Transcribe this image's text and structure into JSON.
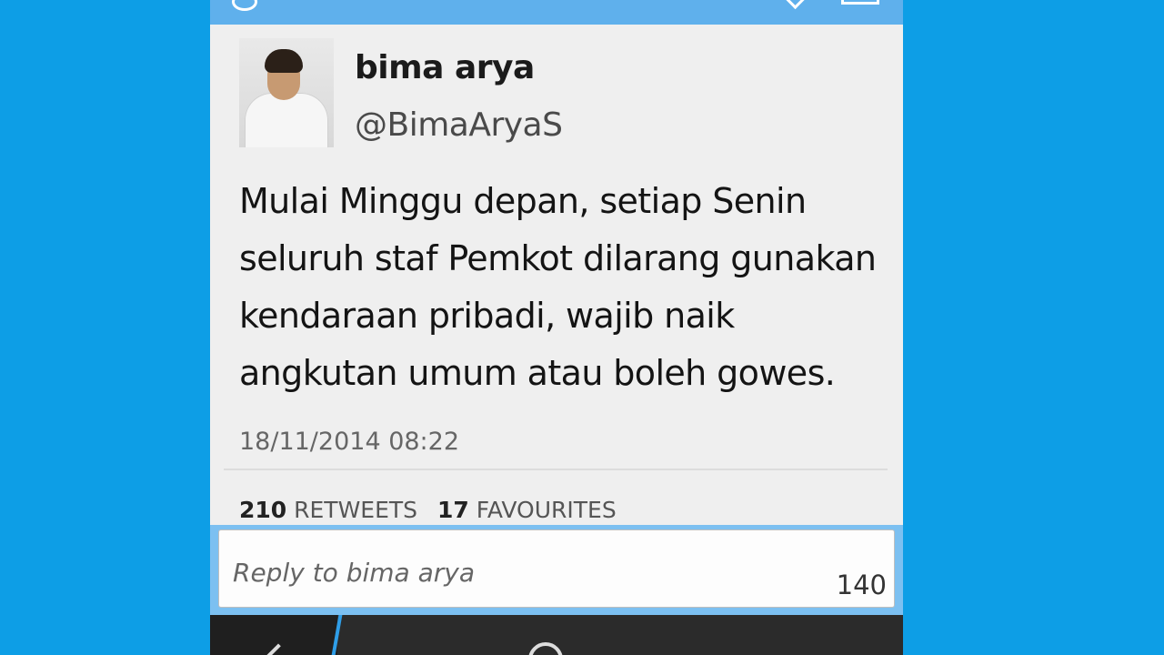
{
  "tweet": {
    "name": "bima arya",
    "handle": "@BimaAryaS",
    "text": "Mulai Minggu depan, setiap Senin seluruh staf Pemkot dilarang gunakan kendaraan pribadi, wajib naik angkutan umum atau boleh gowes.",
    "timestamp": "18/11/2014 08:22",
    "retweets_count": "210",
    "retweets_label": "RETWEETS",
    "favourites_count": "17",
    "favourites_label": "FAVOURITES"
  },
  "reply": {
    "placeholder": "Reply to bima arya",
    "char_count": "140"
  },
  "colors": {
    "background": "#0d9ee6",
    "header": "#5fb0ec",
    "reply_bar": "#7cc0f1",
    "bottom_bar": "#2b2b2b"
  },
  "icons": {
    "avatar": "avatar",
    "bottom_left": "back-icon",
    "bottom_center": "compose-icon"
  }
}
